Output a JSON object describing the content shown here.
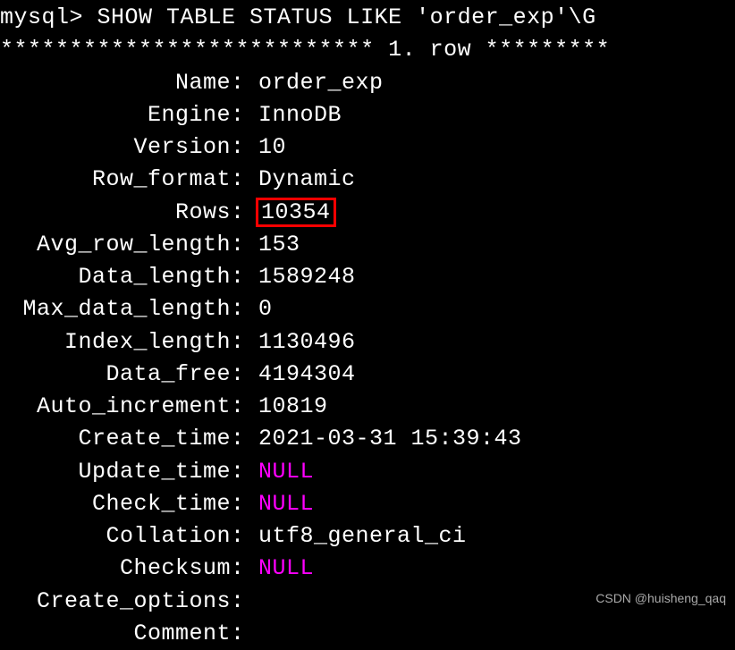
{
  "prompt": "mysql> SHOW TABLE STATUS LIKE 'order_exp'\\G",
  "row_header": "*************************** 1. row *********",
  "fields": [
    {
      "label": "Name",
      "value": "order_exp",
      "highlight": false,
      "null": false
    },
    {
      "label": "Engine",
      "value": "InnoDB",
      "highlight": false,
      "null": false
    },
    {
      "label": "Version",
      "value": "10",
      "highlight": false,
      "null": false
    },
    {
      "label": "Row_format",
      "value": "Dynamic",
      "highlight": false,
      "null": false
    },
    {
      "label": "Rows",
      "value": "10354",
      "highlight": true,
      "null": false
    },
    {
      "label": "Avg_row_length",
      "value": "153",
      "highlight": false,
      "null": false
    },
    {
      "label": "Data_length",
      "value": "1589248",
      "highlight": false,
      "null": false
    },
    {
      "label": "Max_data_length",
      "value": "0",
      "highlight": false,
      "null": false
    },
    {
      "label": "Index_length",
      "value": "1130496",
      "highlight": false,
      "null": false
    },
    {
      "label": "Data_free",
      "value": "4194304",
      "highlight": false,
      "null": false
    },
    {
      "label": "Auto_increment",
      "value": "10819",
      "highlight": false,
      "null": false
    },
    {
      "label": "Create_time",
      "value": "2021-03-31 15:39:43",
      "highlight": false,
      "null": false
    },
    {
      "label": "Update_time",
      "value": "NULL",
      "highlight": false,
      "null": true
    },
    {
      "label": "Check_time",
      "value": "NULL",
      "highlight": false,
      "null": true
    },
    {
      "label": "Collation",
      "value": "utf8_general_ci",
      "highlight": false,
      "null": false
    },
    {
      "label": "Checksum",
      "value": "NULL",
      "highlight": false,
      "null": true
    },
    {
      "label": "Create_options",
      "value": "",
      "highlight": false,
      "null": false
    },
    {
      "label": "Comment",
      "value": "",
      "highlight": false,
      "null": false
    }
  ],
  "watermark": "CSDN @huisheng_qaq"
}
